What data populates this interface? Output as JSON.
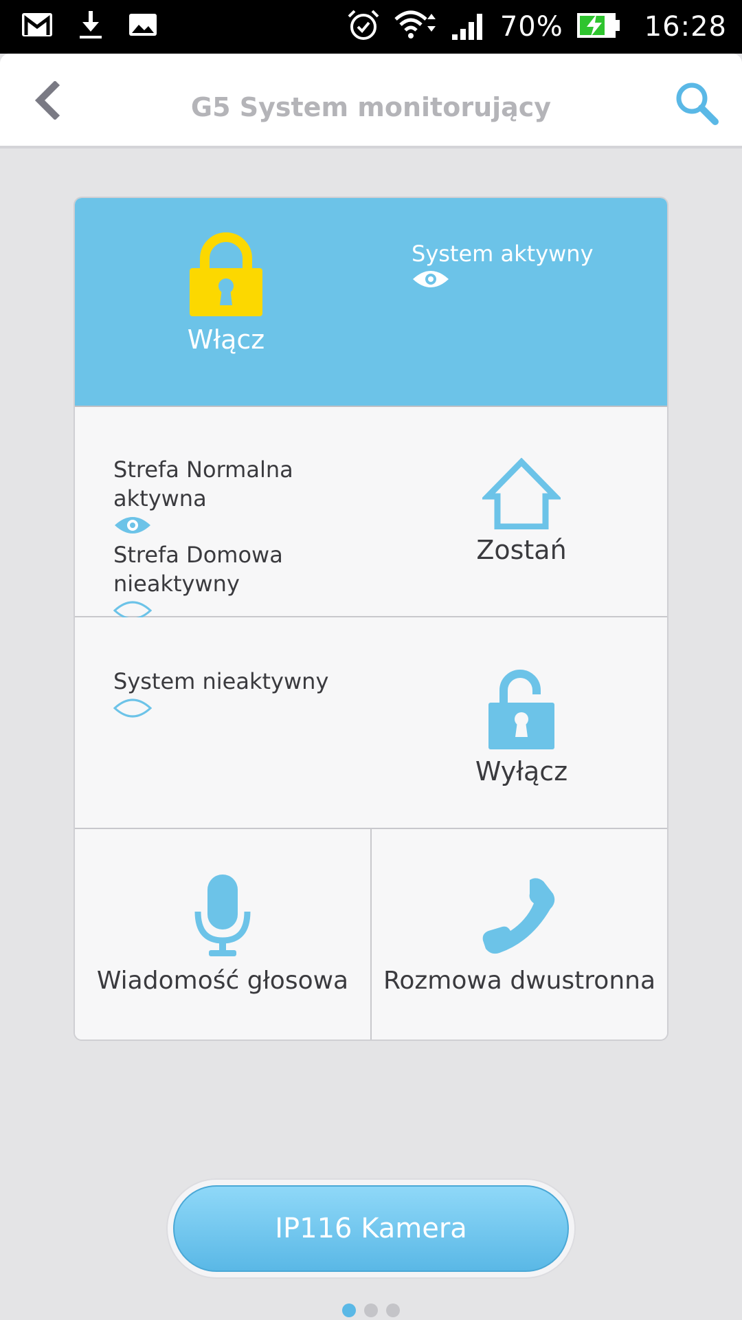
{
  "status_bar": {
    "battery": "70%",
    "time": "16:28",
    "icons": [
      "gmail-icon",
      "download-icon",
      "image-icon",
      "alarm-icon",
      "wifi-icon",
      "signal-icon",
      "battery-charging-icon"
    ]
  },
  "header": {
    "title": "G5 System monitorujący",
    "back_icon": "chevron-left-icon",
    "search_icon": "search-icon"
  },
  "arm_section": {
    "button_label": "Włącz",
    "status_text": "System aktywny",
    "status_active": true
  },
  "home_section": {
    "button_label": "Zostań",
    "status_normal": "Strefa Normalna aktywna",
    "status_normal_active": true,
    "status_home": "Strefa Domowa nieaktywny",
    "status_home_active": false
  },
  "disarm_section": {
    "button_label": "Wyłącz",
    "status_text": "System nieaktywny",
    "status_active": false
  },
  "bottom_actions": {
    "voice_label": "Wiadomość głosowa",
    "call_label": "Rozmowa dwustronna"
  },
  "camera_button": {
    "label": "IP116 Kamera"
  },
  "pagination": {
    "pages": 3,
    "active": 1
  },
  "colors": {
    "accent": "#6cc3e8",
    "lock_yellow": "#fcd800",
    "icon_blue": "#6cc3e8"
  }
}
